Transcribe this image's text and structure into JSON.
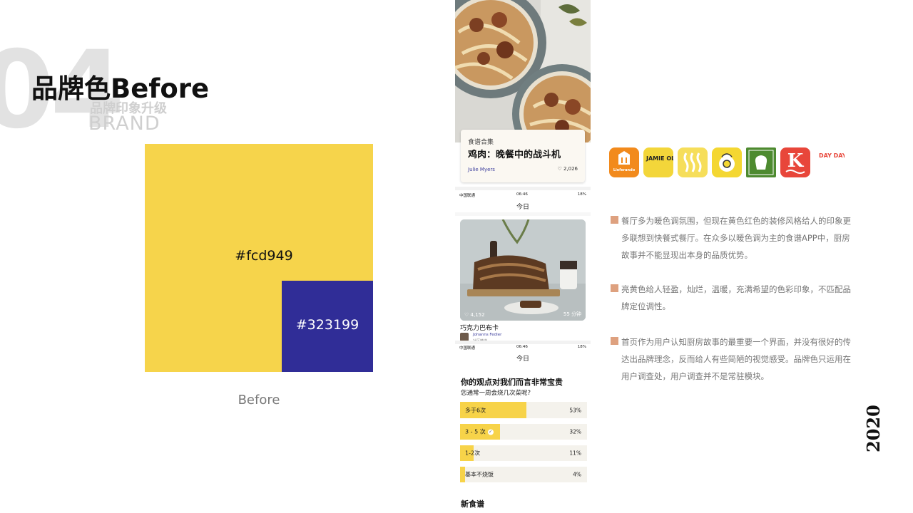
{
  "header": {
    "number": "04",
    "title": "品牌色Before",
    "subtitle": "品牌印象升级",
    "brand_en": "BRAND"
  },
  "palette": {
    "primary": {
      "hex_label": "#fcd949",
      "color": "#f6d44b"
    },
    "secondary": {
      "hex_label": "#323199",
      "color": "#302d97"
    },
    "caption": "Before"
  },
  "phone": {
    "featured": {
      "tag": "食谱合集",
      "title": "鸡肉：晚餐中的战斗机",
      "author": "Julie Myers",
      "likes": "2,026"
    },
    "statusbar_top": {
      "carrier": "中国联通",
      "time": "06:46",
      "battery": "18%"
    },
    "nav_title": "今日",
    "recipe_card": {
      "likes": "4,152",
      "time": "55 分钟",
      "name": "巧克力巴布卡",
      "author": "Johanns Fedler",
      "author_sub": "社区精选"
    },
    "statusbar_bottom": {
      "carrier": "中国联通",
      "time": "06:46",
      "battery": "18%"
    },
    "nav_title_2": "今日",
    "poll": {
      "title": "你的观点对我们而言非常宝贵",
      "question": "您通常一周会烧几次菜呢?",
      "options": [
        {
          "label": "多于6次",
          "pct": "53%",
          "value": 53
        },
        {
          "label": "3 - 5 次",
          "pct": "32%",
          "value": 32,
          "checked": true
        },
        {
          "label": "1-2次",
          "pct": "11%",
          "value": 11
        },
        {
          "label": "基本不烧饭",
          "pct": "4%",
          "value": 4
        }
      ]
    },
    "new_recipes": "新食谱"
  },
  "app_icons": [
    {
      "name": "lieferando-icon",
      "text": "Lieferando",
      "bg": "#f28a1c"
    },
    {
      "name": "jamie-oliver-icon",
      "text": "JAMIE OLIVER",
      "bg": "#f3d63a"
    },
    {
      "name": "steam-waves-icon",
      "text": "",
      "bg": "#f6de5a"
    },
    {
      "name": "egg-chef-icon",
      "text": "",
      "bg": "#f4d732"
    },
    {
      "name": "chef-hat-icon",
      "text": "",
      "bg": "#4d8a2f"
    },
    {
      "name": "k-kitchen-icon",
      "text": "K",
      "bg": "#e8463a"
    },
    {
      "name": "day-day-cook-icon",
      "text": "DAY DAY COOK",
      "bg": "#ffffff"
    }
  ],
  "notes": [
    "餐厅多为暖色调氛围，但现在黄色红色的装修风格给人的印象更多联想到快餐式餐厅。在众多以暖色调为主的食谱APP中，厨房故事并不能显现出本身的品质优势。",
    "亮黄色给人轻盈，灿烂，温暖，充满希望的色彩印象，不匹配品牌定位调性。",
    "首页作为用户认知厨房故事的最重要一个界面，并没有很好的传达出品牌理念，反而给人有些简陋的视觉感受。品牌色只运用在用户调查处，用户调查并不是常驻模块。"
  ],
  "year": "2020"
}
